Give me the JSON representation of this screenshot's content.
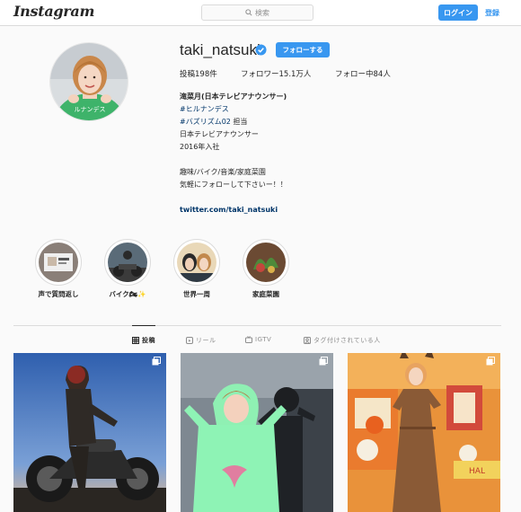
{
  "header": {
    "logo": "Instagram",
    "search_placeholder": "検索",
    "login_label": "ログイン",
    "register_label": "登録"
  },
  "profile": {
    "username": "taki_natsuki",
    "follow_label": "フォローする",
    "stats": {
      "posts": "投稿198件",
      "followers": "フォロワー15.1万人",
      "following": "フォロー中84人"
    },
    "bio": {
      "name": "滝菜月(日本テレビアナウンサー)",
      "tag1": "#ヒルナンデス",
      "tag2": "#バズリズム02",
      "tag2_suffix": " 担当",
      "line3": "日本テレビアナウンサー",
      "line4": "2016年入社",
      "line5": "趣味/バイク/音楽/家庭菜園",
      "line6": "気軽にフォローして下さいー！！",
      "link": "twitter.com/taki_natsuki"
    }
  },
  "highlights": [
    {
      "label": "声で質問返し"
    },
    {
      "label": "バイク🏍✨"
    },
    {
      "label": "世界一周"
    },
    {
      "label": "家庭菜園"
    }
  ],
  "tabs": [
    {
      "label": "投稿",
      "icon": "grid-icon"
    },
    {
      "label": "リール",
      "icon": "reels-icon"
    },
    {
      "label": "IGTV",
      "icon": "igtv-icon"
    },
    {
      "label": "タグ付けされている人",
      "icon": "tagged-icon"
    }
  ],
  "colors": {
    "accent": "#3897f0",
    "link": "#003569",
    "border": "#dbdbdb"
  }
}
